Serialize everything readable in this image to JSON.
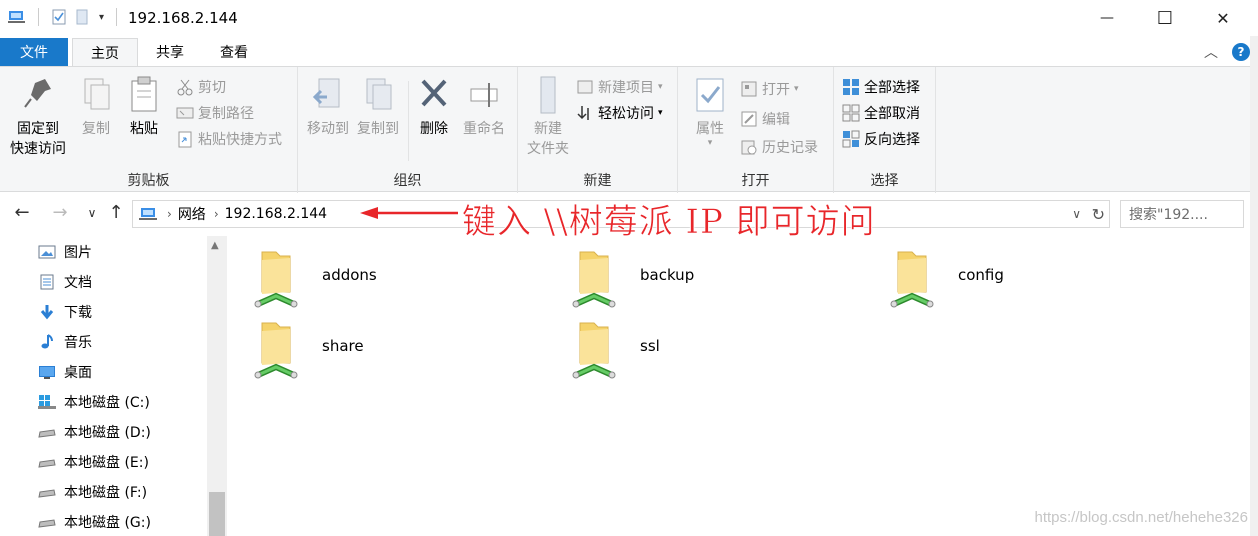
{
  "window": {
    "title": "192.168.2.144",
    "minimize_glyph": "—",
    "maximize_glyph": "☐",
    "close_glyph": "✕"
  },
  "tabs": [
    {
      "label": "文件"
    },
    {
      "label": "主页"
    },
    {
      "label": "共享"
    },
    {
      "label": "查看"
    }
  ],
  "ribbon": {
    "clipboard": {
      "label": "剪贴板",
      "pin_line1": "固定到",
      "pin_line2": "快速访问",
      "copy": "复制",
      "paste": "粘贴",
      "cut": "剪切",
      "copy_path": "复制路径",
      "paste_shortcut": "粘贴快捷方式"
    },
    "organize": {
      "label": "组织",
      "move_to": "移动到",
      "copy_to": "复制到",
      "delete": "删除",
      "rename": "重命名"
    },
    "new": {
      "label": "新建",
      "new_folder_line1": "新建",
      "new_folder_line2": "文件夹",
      "new_item": "新建项目",
      "easy_access": "轻松访问"
    },
    "open": {
      "label": "打开",
      "properties": "属性",
      "open": "打开",
      "edit": "编辑",
      "history": "历史记录"
    },
    "select": {
      "label": "选择",
      "select_all": "全部选择",
      "select_none": "全部取消",
      "invert": "反向选择"
    }
  },
  "address": {
    "crumbs": [
      "网络",
      "192.168.2.144"
    ],
    "search_placeholder": "搜索\"192...."
  },
  "annotation": "键入 \\\\树莓派 IP 即可访问",
  "sidebar": {
    "items": [
      {
        "label": "图片",
        "icon": "pictures-icon"
      },
      {
        "label": "文档",
        "icon": "documents-icon"
      },
      {
        "label": "下载",
        "icon": "download-icon"
      },
      {
        "label": "音乐",
        "icon": "music-icon"
      },
      {
        "label": "桌面",
        "icon": "desktop-icon"
      },
      {
        "label": "本地磁盘 (C:)",
        "icon": "windows-drive-icon"
      },
      {
        "label": "本地磁盘 (D:)",
        "icon": "drive-icon"
      },
      {
        "label": "本地磁盘 (E:)",
        "icon": "drive-icon"
      },
      {
        "label": "本地磁盘 (F:)",
        "icon": "drive-icon"
      },
      {
        "label": "本地磁盘 (G:)",
        "icon": "drive-icon"
      }
    ]
  },
  "folders": [
    {
      "name": "addons"
    },
    {
      "name": "backup"
    },
    {
      "name": "config"
    },
    {
      "name": "share"
    },
    {
      "name": "ssl"
    }
  ],
  "watermark": "https://blog.csdn.net/hehehe326",
  "colors": {
    "accent": "#1979ca",
    "annotation": "#e8262a",
    "folder": "#f5d36b"
  }
}
